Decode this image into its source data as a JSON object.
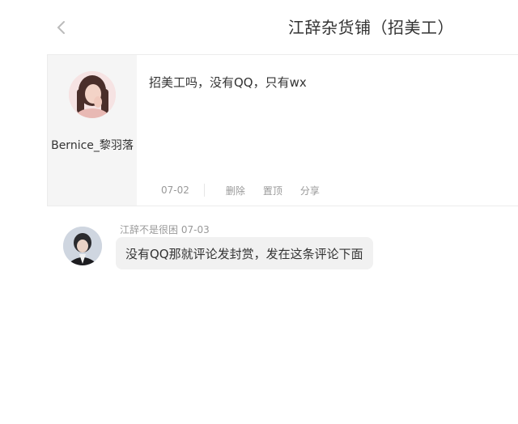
{
  "header": {
    "title": "江辞杂货铺（招美工）",
    "back_icon": "chevron-left-icon"
  },
  "post": {
    "author": "Bernice_黎羽落",
    "content": "招美工吗，没有QQ，只有wx",
    "date": "07-02",
    "actions": {
      "delete": "删除",
      "pin": "置顶",
      "share": "分享"
    }
  },
  "reply": {
    "user": "江辞不是很困",
    "date": "07-03",
    "content": "没有QQ那就评论发封赏，发在这条评论下面"
  }
}
